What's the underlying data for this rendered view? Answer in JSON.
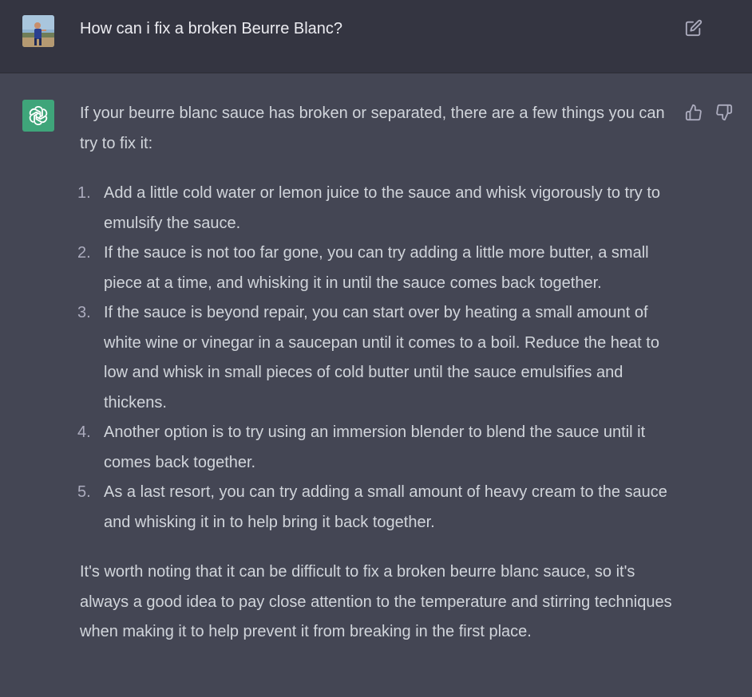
{
  "user_message": {
    "text": "How can i fix a broken Beurre Blanc?",
    "avatar": "user-photo",
    "edit_icon": "edit-icon"
  },
  "assistant_message": {
    "avatar": "openai-logo-icon",
    "accent_color": "#3fa57a",
    "intro": "If your beurre blanc sauce has broken or separated, there are a few things you can try to fix it:",
    "steps": [
      {
        "num": "1.",
        "text": "Add a little cold water or lemon juice to the sauce and whisk vigorously to try to emulsify the sauce."
      },
      {
        "num": "2.",
        "text": "If the sauce is not too far gone, you can try adding a little more butter, a small piece at a time, and whisking it in until the sauce comes back together."
      },
      {
        "num": "3.",
        "text": "If the sauce is beyond repair, you can start over by heating a small amount of white wine or vinegar in a saucepan until it comes to a boil. Reduce the heat to low and whisk in small pieces of cold butter until the sauce emulsifies and thickens."
      },
      {
        "num": "4.",
        "text": "Another option is to try using an immersion blender to blend the sauce until it comes back together."
      },
      {
        "num": "5.",
        "text": "As a last resort, you can try adding a small amount of heavy cream to the sauce and whisking it in to help bring it back together."
      }
    ],
    "closing": "It's worth noting that it can be difficult to fix a broken beurre blanc sauce, so it's always a good idea to pay close attention to the temperature and stirring techniques when making it to help prevent it from breaking in the first place.",
    "feedback": {
      "up_icon": "thumbs-up-icon",
      "down_icon": "thumbs-down-icon"
    }
  },
  "colors": {
    "user_bg": "#343541",
    "assistant_bg": "#444654",
    "text": "#d1d5db"
  }
}
